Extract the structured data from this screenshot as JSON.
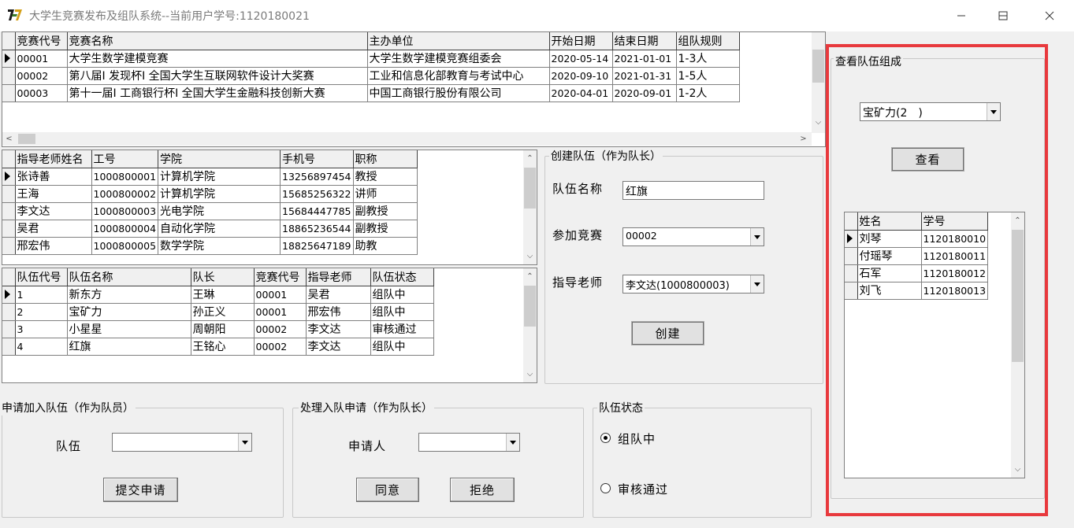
{
  "window": {
    "title": "大学生竞赛发布及组队系统--当前用户学号:1120180021",
    "minimize_icon": "minimize-icon",
    "maximize_icon": "maximize-icon",
    "close_icon": "close-icon"
  },
  "competitions": {
    "headers": [
      "竞赛代号",
      "竞赛名称",
      "主办单位",
      "开始日期",
      "结束日期",
      "组队规则"
    ],
    "rows": [
      [
        "00001",
        "大学生数学建模竞赛",
        "大学生数学建模竞赛组委会",
        "2020-05-14",
        "2021-01-01",
        "1-3人"
      ],
      [
        "00002",
        "第八届I 发现杯I 全国大学生互联网软件设计大奖赛",
        "工业和信息化部教育与考试中心",
        "2020-09-10",
        "2021-01-31",
        "1-5人"
      ],
      [
        "00003",
        "第十一届I 工商银行杯I 全国大学生金融科技创新大赛",
        "中国工商银行股份有限公司",
        "2020-04-01",
        "2020-09-01",
        "1-2人"
      ]
    ]
  },
  "teachers": {
    "headers": [
      "指导老师姓名",
      "工号",
      "学院",
      "手机号",
      "职称"
    ],
    "rows": [
      [
        "张诗善",
        "1000800001",
        "计算机学院",
        "13256897454",
        "教授"
      ],
      [
        "王海",
        "1000800002",
        "计算机学院",
        "15685256322",
        "讲师"
      ],
      [
        "李文达",
        "1000800003",
        "光电学院",
        "15684447785",
        "副教授"
      ],
      [
        "吴君",
        "1000800004",
        "自动化学院",
        "18865236544",
        "副教授"
      ],
      [
        "邢宏伟",
        "1000800005",
        "数学学院",
        "18825647189",
        "助教"
      ]
    ]
  },
  "teams": {
    "headers": [
      "队伍代号",
      "队伍名称",
      "队长",
      "竞赛代号",
      "指导老师",
      "队伍状态"
    ],
    "rows": [
      [
        "1",
        "新东方",
        "王琳",
        "00001",
        "吴君",
        "组队中"
      ],
      [
        "2",
        "宝矿力",
        "孙正义",
        "00001",
        "邢宏伟",
        "组队中"
      ],
      [
        "3",
        "小星星",
        "周朝阳",
        "00002",
        "李文达",
        "审核通过"
      ],
      [
        "4",
        "红旗",
        "王铭心",
        "00002",
        "李文达",
        "组队中"
      ]
    ]
  },
  "create_team": {
    "group_title": "创建队伍（作为队长）",
    "name_label": "队伍名称",
    "name_value": "红旗",
    "competition_label": "参加竞赛",
    "competition_value": "00002",
    "teacher_label": "指导老师",
    "teacher_value": "李文达(1000800003)",
    "create_button": "创建"
  },
  "join_team": {
    "group_title": "申请加入队伍（作为队员）",
    "team_label": "队伍",
    "team_value": "",
    "submit_button": "提交申请"
  },
  "handle_requests": {
    "group_title": "处理入队申请（作为队长）",
    "applicant_label": "申请人",
    "applicant_value": "",
    "agree_button": "同意",
    "reject_button": "拒绝"
  },
  "team_status": {
    "group_title": "队伍状态",
    "option_forming": "组队中",
    "option_approved": "审核通过",
    "selected": "组队中"
  },
  "view_team": {
    "group_title": "查看队伍组成",
    "team_value": "宝矿力(2　)",
    "view_button": "查看",
    "members": {
      "headers": [
        "姓名",
        "学号"
      ],
      "rows": [
        [
          "刘琴",
          "1120180010"
        ],
        [
          "付瑶琴",
          "1120180011"
        ],
        [
          "石军",
          "1120180012"
        ],
        [
          "刘飞",
          "1120180013"
        ]
      ]
    }
  },
  "colors": {
    "highlight_border": "#e8393d",
    "window_bg": "#f0f0f0"
  }
}
